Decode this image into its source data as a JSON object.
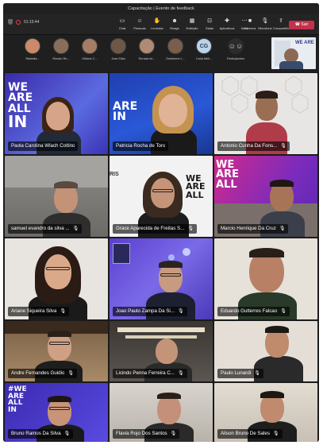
{
  "window": {
    "title": "Capacitação | Evento de feedback",
    "rec_time": "01:15:44"
  },
  "toolbar": {
    "buttons": [
      {
        "label": "Chat",
        "icon": "chat-icon"
      },
      {
        "label": "Pessoas",
        "icon": "people-icon"
      },
      {
        "label": "Levantar",
        "icon": "raise-hand-icon"
      },
      {
        "label": "Reagir",
        "icon": "react-icon"
      },
      {
        "label": "Exibição",
        "icon": "view-icon"
      },
      {
        "label": "Salas",
        "icon": "rooms-icon"
      },
      {
        "label": "Aplicativos",
        "icon": "apps-icon"
      },
      {
        "label": "Mais",
        "icon": "more-icon"
      },
      {
        "label": "Câmera",
        "icon": "camera-icon"
      },
      {
        "label": "Microfone",
        "icon": "mic-icon"
      },
      {
        "label": "Compartilhar",
        "icon": "share-icon"
      }
    ],
    "leave_label": "Sair"
  },
  "strip": {
    "thumbnails": [
      {
        "name": "Rafaelia...",
        "color": "#c98b6a"
      },
      {
        "name": "Renato Re...",
        "color": "#8a6e5a"
      },
      {
        "name": "Gilliane C...",
        "color": "#a67c64"
      },
      {
        "name": "Jose Elias",
        "color": "#6d5847"
      },
      {
        "name": "Renata Int...",
        "color": "#b08a73"
      },
      {
        "name": "Guilherme L...",
        "color": "#7a5e4d"
      },
      {
        "name": "Carla Mell...",
        "initials": "CG"
      },
      {
        "name": "Participantes",
        "color": "#2c2c2c"
      }
    ]
  },
  "grid": {
    "participants": [
      {
        "name": "Paola Carolina Wlach Coltino"
      },
      {
        "name": "Patricia Rocha de Toro"
      },
      {
        "name": "Antonio Cunha Da Fons..."
      },
      {
        "name": "samuel evandro da silva ..."
      },
      {
        "name": "Grace Aparecida de Freitas S..."
      },
      {
        "name": "Marcio Henrique Da Cruz"
      },
      {
        "name": "Ariane Siqueira Silva"
      },
      {
        "name": "Joao Paulo Zampa Da Si..."
      },
      {
        "name": "Eduardo Gutterres Falcao"
      },
      {
        "name": "Andre Fernandes Guidio"
      },
      {
        "name": "Licindo Penna Ferreira C..."
      },
      {
        "name": "Paulo Lunardi"
      },
      {
        "name": "Bruno Ramos Da Silva"
      },
      {
        "name": "Flavia Rojo Dos Santos"
      },
      {
        "name": "Alison Bruno De Sales"
      }
    ],
    "wall_lines": {
      "we": "WE",
      "are": "ARE",
      "all": "ALL",
      "in": "IN",
      "are_all": "ARE\nALL",
      "hash_we": "#WE"
    },
    "share_banner": "WE ARE"
  }
}
